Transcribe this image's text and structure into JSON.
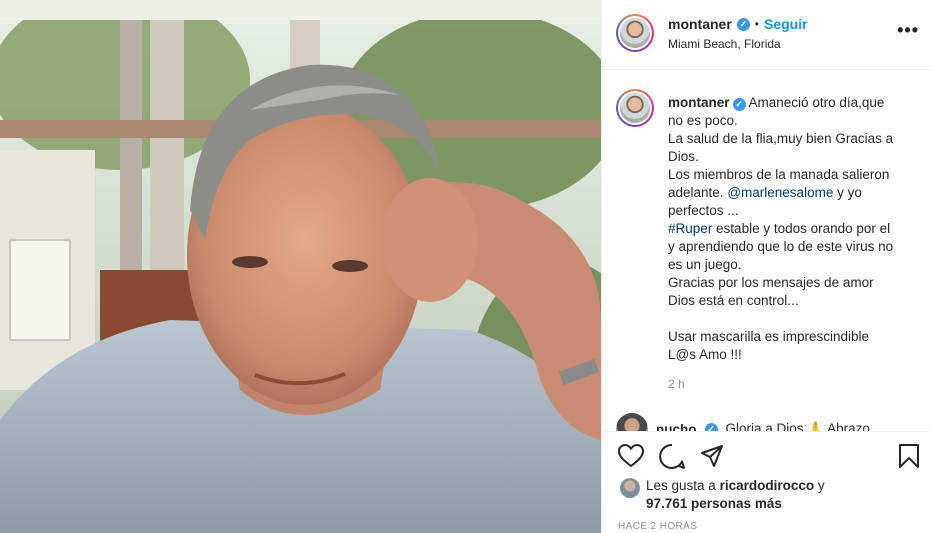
{
  "post": {
    "username": "montaner",
    "verified_badge": "✓",
    "follow_sep": "•",
    "follow_label": "Seguir",
    "location": "Miami Beach, Florida",
    "more_icon": "•••"
  },
  "caption": {
    "username": "montaner",
    "lines": [
      "Amaneció otro día,que",
      "no es poco.",
      "La salud de la flia,muy bien Gracias a",
      "Dios.",
      "Los miembros de la manada salieron",
      "adelante.",
      "@marlenesalome",
      "y yo",
      "perfectos ...",
      "#Ruper",
      "estable y todos orando por el",
      "y aprendiendo que lo de este virus no",
      "es un juego.",
      "Gracias por los mensajes de amor",
      "Dios está en control...",
      "Usar mascarilla es imprescindible",
      "L@s Amo !!!"
    ],
    "time": "2 h"
  },
  "comment": {
    "username": "nucho",
    "text": "Gloria a Dios 🙏 Abrazo",
    "more": "..."
  },
  "likes": {
    "prefix": "Les gusta a",
    "user": "ricardodirocco",
    "conj": "y",
    "count": "97.761 personas más"
  },
  "post_time": "HACE 2 HORAS",
  "icons": [
    "heart-icon",
    "comment-icon",
    "share-icon",
    "bookmark-icon"
  ]
}
